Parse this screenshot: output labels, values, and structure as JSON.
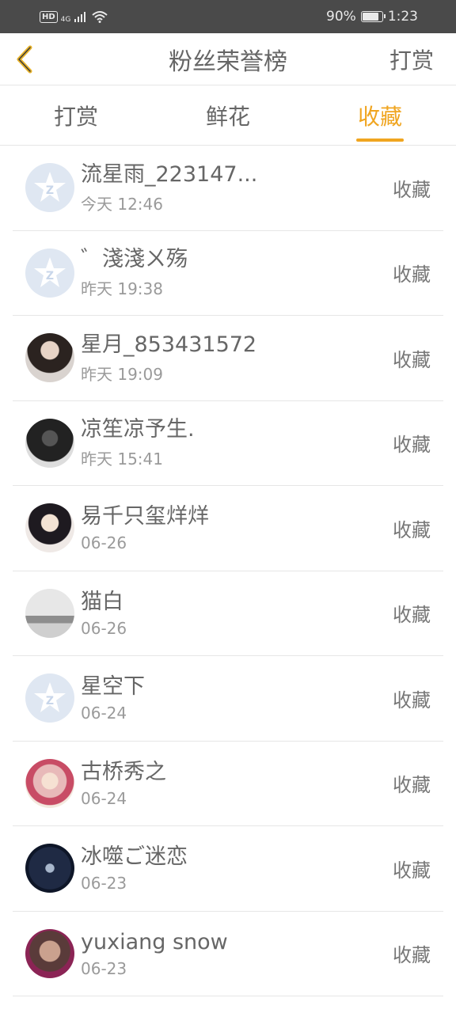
{
  "status_bar": {
    "hd": "HD",
    "network": "4G",
    "battery_percent": "90%",
    "battery_level": 0.9,
    "time": "1:23"
  },
  "header": {
    "title": "粉丝荣誉榜",
    "right_action": "打赏"
  },
  "tabs": [
    {
      "label": "打赏",
      "active": false
    },
    {
      "label": "鲜花",
      "active": false
    },
    {
      "label": "收藏",
      "active": true
    }
  ],
  "rows": [
    {
      "name": "流星雨_223147...",
      "time": "今天 12:46",
      "action": "收藏",
      "avatar": "default"
    },
    {
      "name": "゛淺淺ㄨ殇",
      "time": "昨天 19:38",
      "action": "收藏",
      "avatar": "default"
    },
    {
      "name": "星月_853431572",
      "time": "昨天 19:09",
      "action": "收藏",
      "avatar": "photo"
    },
    {
      "name": "凉笙凉予生.",
      "time": "昨天 15:41",
      "action": "收藏",
      "avatar": "photo"
    },
    {
      "name": "易千只玺烊烊",
      "time": "06-26",
      "action": "收藏",
      "avatar": "photo"
    },
    {
      "name": "猫白",
      "time": "06-26",
      "action": "收藏",
      "avatar": "photo"
    },
    {
      "name": "星空下",
      "time": "06-24",
      "action": "收藏",
      "avatar": "default"
    },
    {
      "name": "古桥秀之",
      "time": "06-24",
      "action": "收藏",
      "avatar": "photo"
    },
    {
      "name": "冰噬ご迷恋",
      "time": "06-23",
      "action": "收藏",
      "avatar": "photo"
    },
    {
      "name": "yuxiang snow",
      "time": "06-23",
      "action": "收藏",
      "avatar": "photo"
    }
  ],
  "colors": {
    "accent": "#f0a520",
    "status_bar": "#4a4a4a",
    "default_avatar": "#dfe7f2"
  }
}
